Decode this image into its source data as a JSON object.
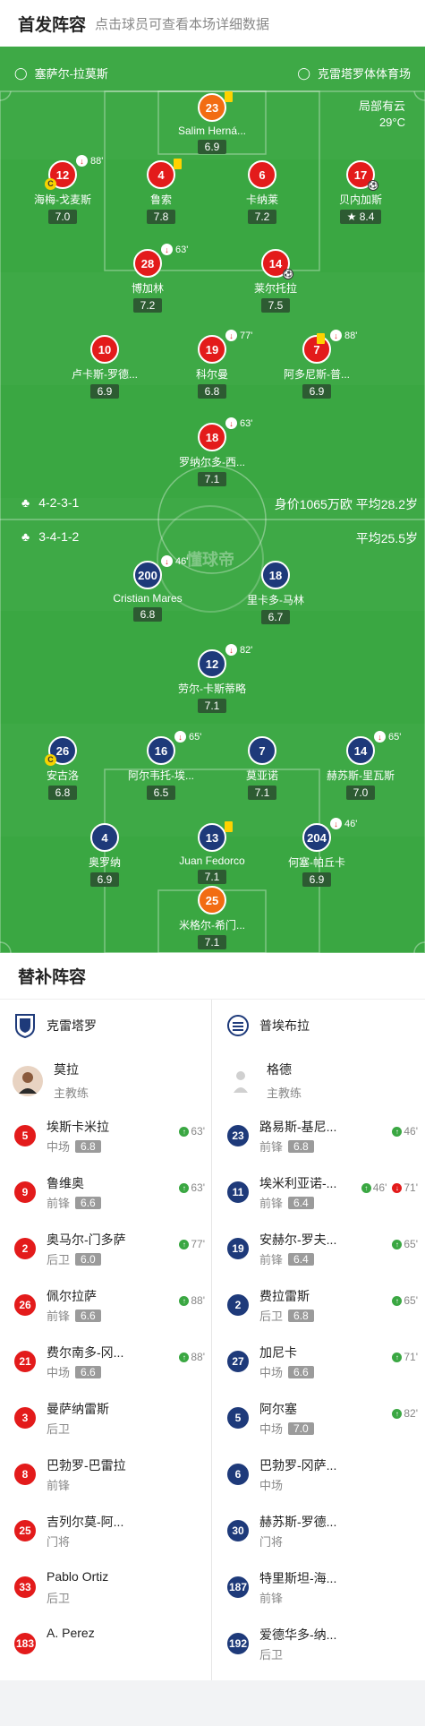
{
  "header": {
    "title": "首发阵容",
    "subtitle": "点击球员可查看本场详细数据"
  },
  "venue": {
    "left": "塞萨尔-拉莫斯",
    "right": "克雷塔罗体体育场"
  },
  "weather": {
    "condition": "局部有云",
    "temp": "29°C"
  },
  "watermark": "懂球帝",
  "home_team": {
    "formation": "4-2-3-1",
    "stats": "身价1065万欧 平均28.2岁",
    "players": [
      {
        "num": "23",
        "name": "Salim Herná...",
        "rating": "6.9",
        "color": "orange"
      },
      {
        "num": "12",
        "name": "海梅-戈麦斯",
        "rating": "7.0",
        "color": "red",
        "sub": "88'"
      },
      {
        "num": "4",
        "name": "鲁索",
        "rating": "7.8",
        "color": "red"
      },
      {
        "num": "6",
        "name": "卡纳莱",
        "rating": "7.2",
        "color": "red"
      },
      {
        "num": "17",
        "name": "贝内加斯",
        "rating": "8.4",
        "color": "red"
      },
      {
        "num": "28",
        "name": "博加林",
        "rating": "7.2",
        "color": "red",
        "sub": "63'"
      },
      {
        "num": "14",
        "name": "莱尔托拉",
        "rating": "7.5",
        "color": "red"
      },
      {
        "num": "10",
        "name": "卢卡斯-罗德...",
        "rating": "6.9",
        "color": "red"
      },
      {
        "num": "19",
        "name": "科尔曼",
        "rating": "6.8",
        "color": "red",
        "sub": "77'"
      },
      {
        "num": "7",
        "name": "阿多尼斯-普...",
        "rating": "6.9",
        "color": "red",
        "sub": "88'"
      },
      {
        "num": "18",
        "name": "罗纳尔多-西...",
        "rating": "7.1",
        "color": "red",
        "sub": "63'"
      }
    ]
  },
  "away_team": {
    "formation": "3-4-1-2",
    "stats": "平均25.5岁",
    "players": [
      {
        "num": "200",
        "name": "Cristian Mares",
        "rating": "6.8",
        "color": "blue",
        "sub": "46'"
      },
      {
        "num": "18",
        "name": "里卡多-马林",
        "rating": "6.7",
        "color": "blue"
      },
      {
        "num": "12",
        "name": "劳尔-卡斯蒂略",
        "rating": "7.1",
        "color": "blue",
        "sub": "82'"
      },
      {
        "num": "26",
        "name": "安古洛",
        "rating": "6.8",
        "color": "blue"
      },
      {
        "num": "16",
        "name": "阿尔韦托-埃...",
        "rating": "6.5",
        "color": "blue",
        "sub": "65'"
      },
      {
        "num": "7",
        "name": "莫亚诺",
        "rating": "7.1",
        "color": "blue"
      },
      {
        "num": "14",
        "name": "赫苏斯-里瓦斯",
        "rating": "7.0",
        "color": "blue",
        "sub": "65'"
      },
      {
        "num": "4",
        "name": "奥罗纳",
        "rating": "6.9",
        "color": "blue"
      },
      {
        "num": "13",
        "name": "Juan Fedorco",
        "rating": "7.1",
        "color": "blue"
      },
      {
        "num": "204",
        "name": "何塞-帕丘卡",
        "rating": "6.9",
        "color": "blue",
        "sub": "46'"
      },
      {
        "num": "25",
        "name": "米格尔-希门...",
        "rating": "7.1",
        "color": "orange"
      }
    ]
  },
  "subs": {
    "title": "替补阵容",
    "left": {
      "team": "克雷塔罗",
      "coach": {
        "name": "莫拉",
        "role": "主教练"
      },
      "players": [
        {
          "num": "5",
          "name": "埃斯卡米拉",
          "pos": "中场",
          "rating": "6.8",
          "min": "63'"
        },
        {
          "num": "9",
          "name": "鲁维奥",
          "pos": "前锋",
          "rating": "6.6",
          "min": "63'"
        },
        {
          "num": "2",
          "name": "奥马尔-门多萨",
          "pos": "后卫",
          "rating": "6.0",
          "min": "77'"
        },
        {
          "num": "26",
          "name": "佩尔拉萨",
          "pos": "前锋",
          "rating": "6.6",
          "min": "88'"
        },
        {
          "num": "21",
          "name": "费尔南多-冈...",
          "pos": "中场",
          "rating": "6.6",
          "min": "88'"
        },
        {
          "num": "3",
          "name": "曼萨纳雷斯",
          "pos": "后卫",
          "rating": "",
          "min": ""
        },
        {
          "num": "8",
          "name": "巴勃罗-巴雷拉",
          "pos": "前锋",
          "rating": "",
          "min": ""
        },
        {
          "num": "25",
          "name": "吉列尔莫-阿...",
          "pos": "门将",
          "rating": "",
          "min": ""
        },
        {
          "num": "33",
          "name": "Pablo Ortiz",
          "pos": "后卫",
          "rating": "",
          "min": ""
        },
        {
          "num": "183",
          "name": "A. Perez",
          "pos": "",
          "rating": "",
          "min": ""
        }
      ]
    },
    "right": {
      "team": "普埃布拉",
      "coach": {
        "name": "格德",
        "role": "主教练"
      },
      "players": [
        {
          "num": "23",
          "name": "路易斯-基尼...",
          "pos": "前锋",
          "rating": "6.8",
          "min": "46'"
        },
        {
          "num": "11",
          "name": "埃米利亚诺-...",
          "pos": "前锋",
          "rating": "6.4",
          "min": "46'",
          "min_out": "71'"
        },
        {
          "num": "19",
          "name": "安赫尔-罗夫...",
          "pos": "前锋",
          "rating": "6.4",
          "min": "65'"
        },
        {
          "num": "2",
          "name": "费拉雷斯",
          "pos": "后卫",
          "rating": "6.8",
          "min": "65'"
        },
        {
          "num": "27",
          "name": "加尼卡",
          "pos": "中场",
          "rating": "6.6",
          "min": "71'"
        },
        {
          "num": "5",
          "name": "阿尔塞",
          "pos": "中场",
          "rating": "7.0",
          "min": "82'"
        },
        {
          "num": "6",
          "name": "巴勃罗-冈萨...",
          "pos": "中场",
          "rating": "",
          "min": ""
        },
        {
          "num": "30",
          "name": "赫苏斯-罗德...",
          "pos": "门将",
          "rating": "",
          "min": ""
        },
        {
          "num": "187",
          "name": "特里斯坦-海...",
          "pos": "前锋",
          "rating": "",
          "min": ""
        },
        {
          "num": "192",
          "name": "爱德华多-纳...",
          "pos": "后卫",
          "rating": "",
          "min": ""
        }
      ]
    }
  }
}
